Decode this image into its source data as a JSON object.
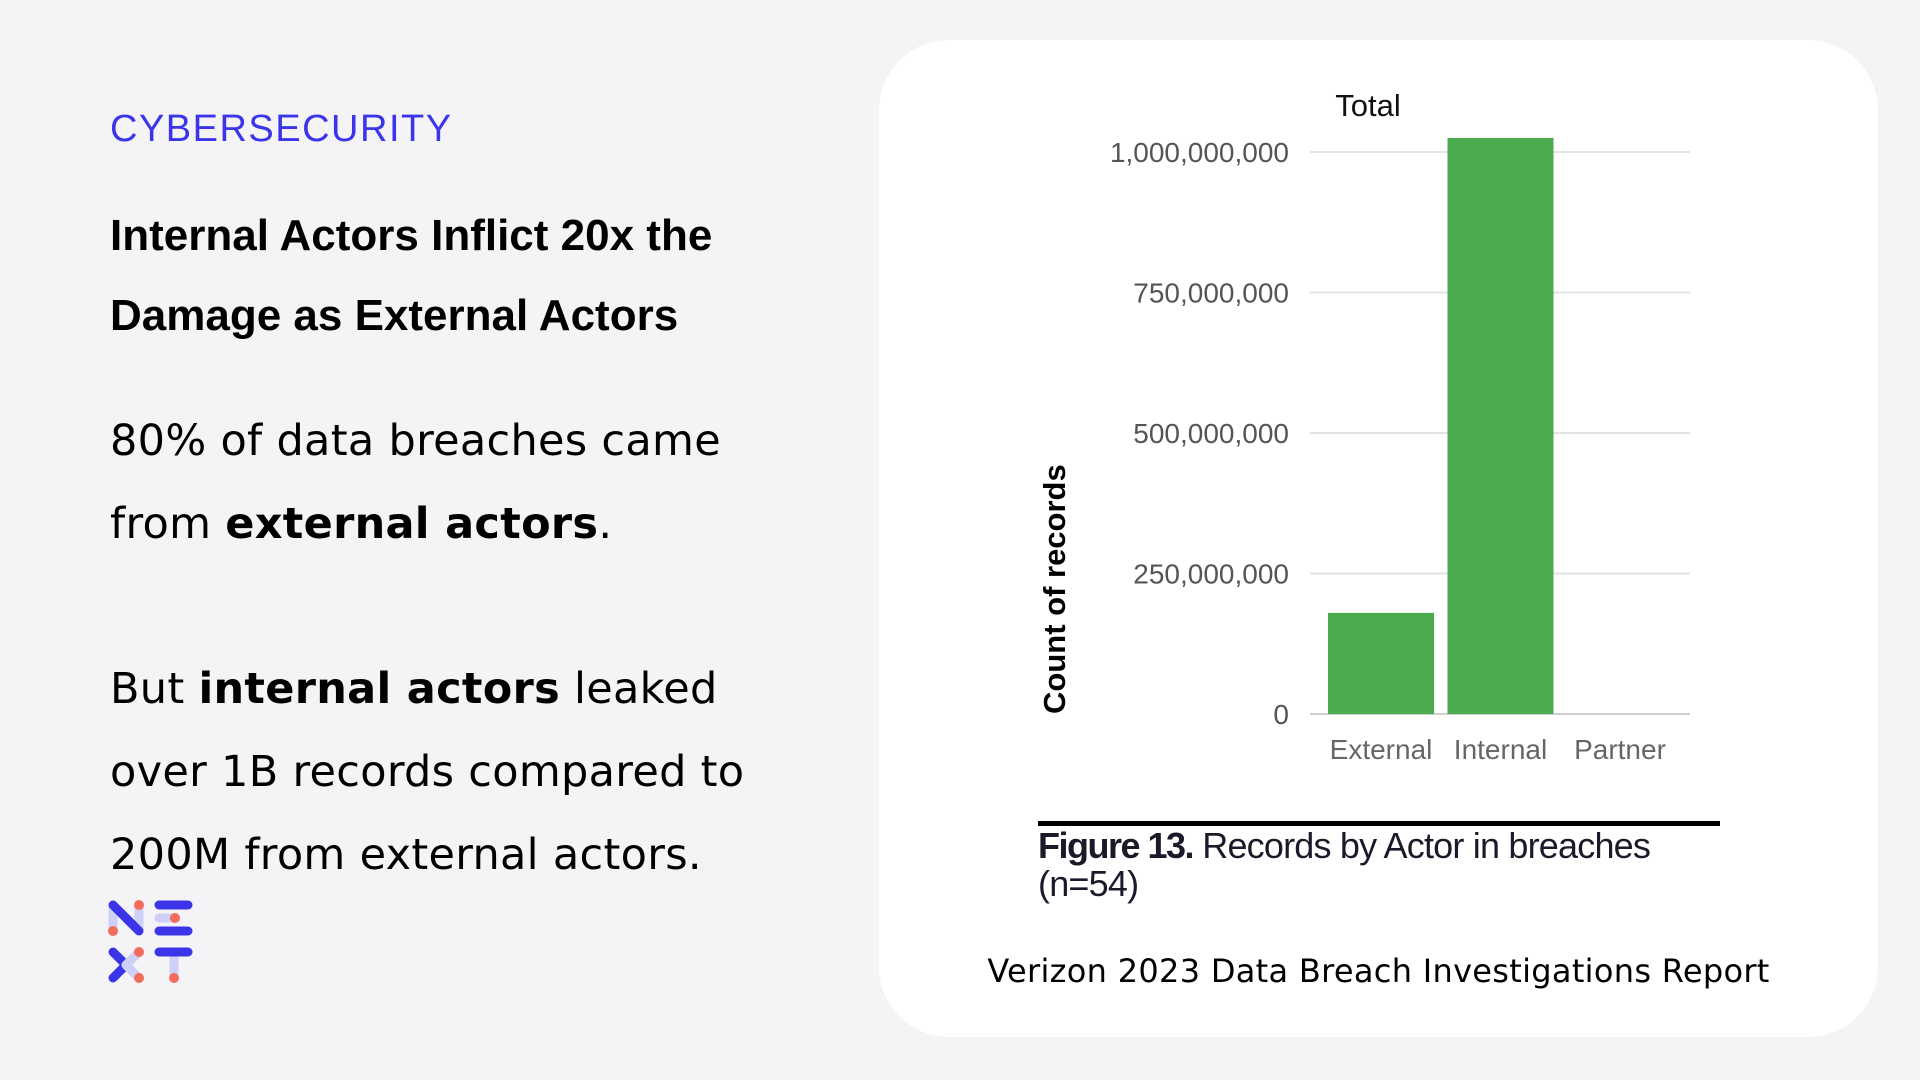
{
  "left": {
    "eyebrow": "CYBERSECURITY",
    "headline": "Internal Actors Inflict 20x the Damage as External Actors",
    "paragraph1": {
      "pre": "80% of data breaches came from ",
      "bold": "external actors",
      "post": "."
    },
    "paragraph2": {
      "pre": "But ",
      "bold": "internal actors",
      "post": " leaked over 1B records compared to 200M from external actors."
    },
    "logo": "NEXT"
  },
  "colors": {
    "accent": "#3b34e8",
    "logo_light": "#cfd0f7",
    "logo_dot": "#f26b5b",
    "bar": "#4caa4f",
    "gridline": "#e3e3e3",
    "background": "#f4f4f7"
  },
  "chart_data": {
    "type": "bar",
    "title": "Total",
    "xlabel": "",
    "ylabel": "Count of records",
    "categories": [
      "External",
      "Internal",
      "Partner"
    ],
    "values": [
      180000000,
      1025000000,
      0
    ],
    "ylim": [
      0,
      1000000000
    ],
    "yticks": [
      0,
      250000000,
      500000000,
      750000000,
      1000000000
    ],
    "ytick_labels": [
      "0",
      "250,000,000",
      "500,000,000",
      "750,000,000",
      "1,000,000,000"
    ],
    "grid": true,
    "legend": "none"
  },
  "caption": {
    "figure_label": "Figure 13.",
    "text": " Records by Actor in breaches (n=54)"
  },
  "source": "Verizon 2023 Data Breach Investigations Report"
}
